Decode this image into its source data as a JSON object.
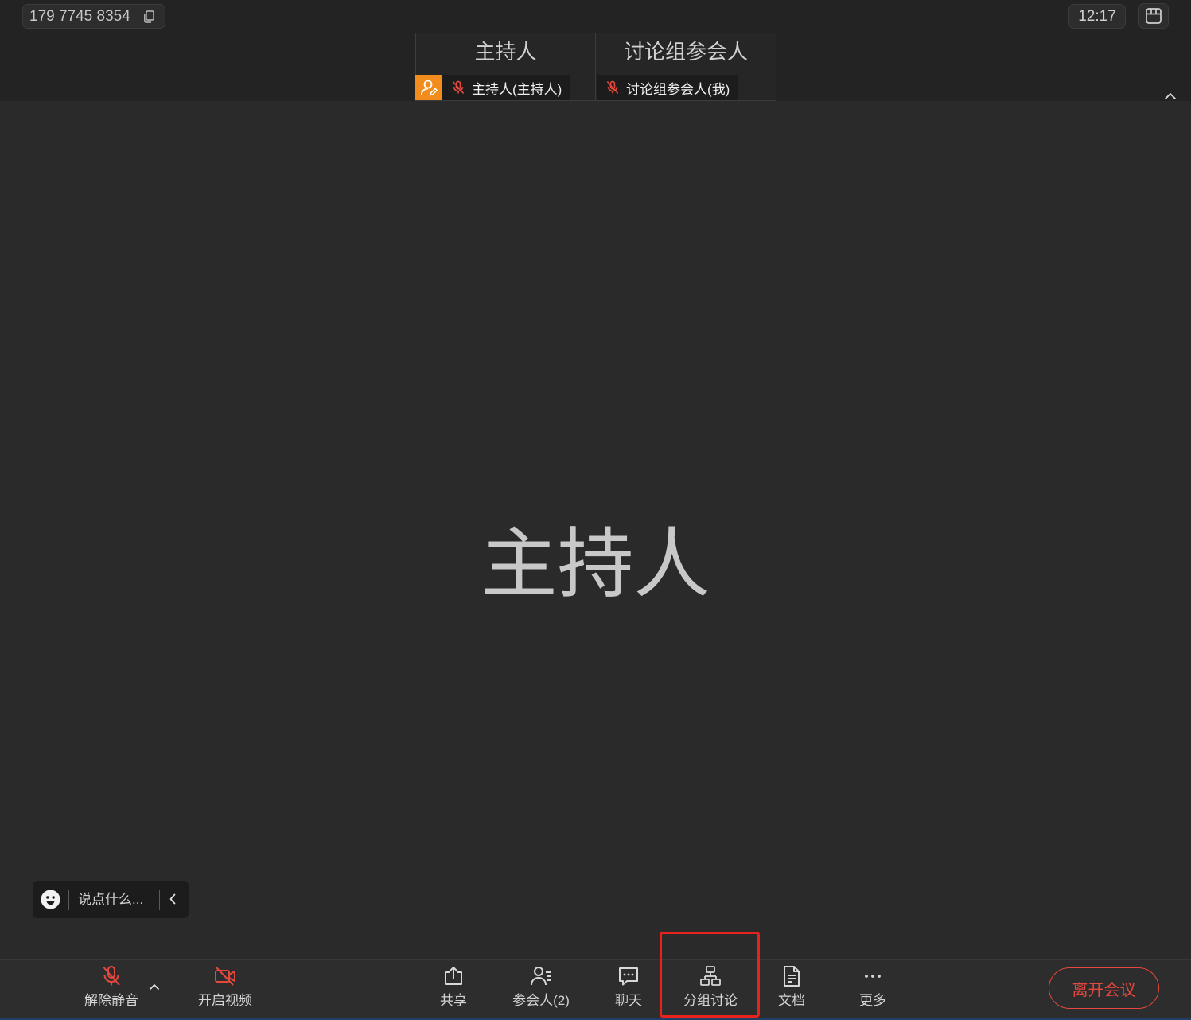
{
  "top_bar": {
    "meeting_id": "179 7745 8354",
    "time": "12:17"
  },
  "participants": [
    {
      "title": "主持人",
      "name_label": "主持人(主持人)"
    },
    {
      "title": "讨论组参会人",
      "name_label": "讨论组参会人(我)"
    }
  ],
  "main_view": {
    "speaker_name": "主持人"
  },
  "chat_input": {
    "placeholder": "说点什么..."
  },
  "toolbar": {
    "unmute_label": "解除静音",
    "start_video_label": "开启视频",
    "share_label": "共享",
    "participants_label": "参会人(2)",
    "chat_label": "聊天",
    "breakout_label": "分组讨论",
    "docs_label": "文档",
    "more_label": "更多",
    "leave_label": "离开会议"
  },
  "icons": {
    "top_bar": [
      "copy-icon",
      "layout-icon"
    ],
    "thumbnail_strip": [
      "host-badge-icon",
      "mic-muted-icon",
      "chevron-up-icon"
    ],
    "chat_input": [
      "smiley-icon",
      "chevron-left-icon"
    ],
    "toolbar": [
      "mic-muted-icon",
      "chevron-up-icon",
      "video-off-icon",
      "share-icon",
      "participants-icon",
      "chat-icon",
      "breakout-icon",
      "document-icon",
      "more-icon"
    ]
  },
  "colors": {
    "accent": "#e5483f",
    "host": "#f28c1c",
    "highlight": "#e8231e"
  }
}
